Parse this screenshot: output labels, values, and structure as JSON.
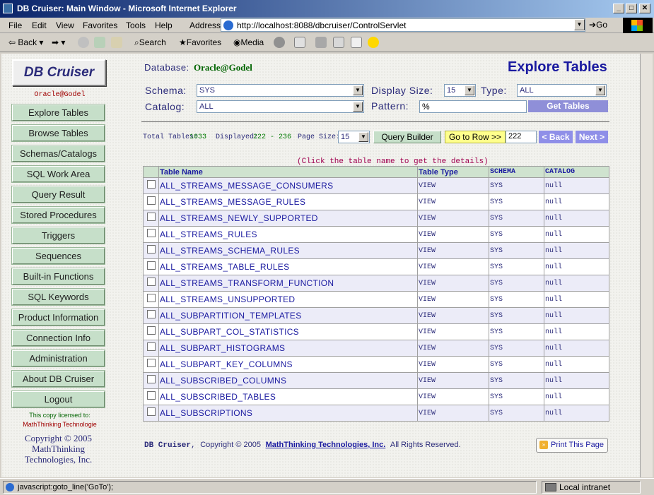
{
  "window": {
    "title": "DB Cruiser: Main Window - Microsoft Internet Explorer"
  },
  "menu": [
    "File",
    "Edit",
    "View",
    "Favorites",
    "Tools",
    "Help"
  ],
  "address": {
    "label": "Address",
    "url": "http://localhost:8088/dbcruiser/ControlServlet",
    "go": "Go"
  },
  "toolbar": {
    "back": "Back",
    "search": "Search",
    "favorites": "Favorites",
    "media": "Media"
  },
  "sidebar": {
    "logo": "DB Cruiser",
    "db": "Oracle@Godel",
    "items": [
      "Explore Tables",
      "Browse Tables",
      "Schemas/Catalogs",
      "SQL Work Area",
      "Query Result",
      "Stored Procedures",
      "Triggers",
      "Sequences",
      "Built-in Functions",
      "SQL Keywords",
      "Product Information",
      "Connection Info",
      "Administration",
      "About DB Cruiser",
      "Logout"
    ],
    "licensed_label": "This copy licensed to:",
    "licensee": "MathThinking Technologie",
    "copyright": [
      "Copyright © 2005",
      "MathThinking",
      "Technologies, Inc."
    ]
  },
  "header": {
    "database_label": "Database:",
    "database": "Oracle@Godel",
    "title": "Explore Tables",
    "schema_label": "Schema:",
    "schema": "SYS",
    "display_size_label": "Display Size:",
    "display_size": "15",
    "type_label": "Type:",
    "type": "ALL",
    "catalog_label": "Catalog:",
    "catalog": "ALL",
    "pattern_label": "Pattern:",
    "pattern": "%",
    "get_tables": "Get Tables"
  },
  "pager": {
    "total_label": "Total Tables:",
    "total": "1033",
    "displayed_label": "Displayed:",
    "displayed": "222 - 236",
    "page_size_label": "Page Size:",
    "page_size": "15",
    "query_builder": "Query Builder",
    "goto_row": "Go to Row >>",
    "row_value": "222",
    "back": "< Back",
    "next": "Next >"
  },
  "hint": "(Click the table name to get the details)",
  "table": {
    "headers": [
      "Table Name",
      "Table Type",
      "SCHEMA",
      "CATALOG"
    ],
    "rows": [
      [
        "ALL_STREAMS_MESSAGE_CONSUMERS",
        "VIEW",
        "SYS",
        "null"
      ],
      [
        "ALL_STREAMS_MESSAGE_RULES",
        "VIEW",
        "SYS",
        "null"
      ],
      [
        "ALL_STREAMS_NEWLY_SUPPORTED",
        "VIEW",
        "SYS",
        "null"
      ],
      [
        "ALL_STREAMS_RULES",
        "VIEW",
        "SYS",
        "null"
      ],
      [
        "ALL_STREAMS_SCHEMA_RULES",
        "VIEW",
        "SYS",
        "null"
      ],
      [
        "ALL_STREAMS_TABLE_RULES",
        "VIEW",
        "SYS",
        "null"
      ],
      [
        "ALL_STREAMS_TRANSFORM_FUNCTION",
        "VIEW",
        "SYS",
        "null"
      ],
      [
        "ALL_STREAMS_UNSUPPORTED",
        "VIEW",
        "SYS",
        "null"
      ],
      [
        "ALL_SUBPARTITION_TEMPLATES",
        "VIEW",
        "SYS",
        "null"
      ],
      [
        "ALL_SUBPART_COL_STATISTICS",
        "VIEW",
        "SYS",
        "null"
      ],
      [
        "ALL_SUBPART_HISTOGRAMS",
        "VIEW",
        "SYS",
        "null"
      ],
      [
        "ALL_SUBPART_KEY_COLUMNS",
        "VIEW",
        "SYS",
        "null"
      ],
      [
        "ALL_SUBSCRIBED_COLUMNS",
        "VIEW",
        "SYS",
        "null"
      ],
      [
        "ALL_SUBSCRIBED_TABLES",
        "VIEW",
        "SYS",
        "null"
      ],
      [
        "ALL_SUBSCRIPTIONS",
        "VIEW",
        "SYS",
        "null"
      ]
    ]
  },
  "footer": {
    "brand": "DB Cruiser",
    "copyright": "Copyright © 2005",
    "company": "MathThinking Technologies, Inc.",
    "rights": "All Rights Reserved.",
    "print": "Print This Page"
  },
  "status": {
    "text": "javascript:goto_line('GoTo');",
    "zone": "Local intranet"
  }
}
